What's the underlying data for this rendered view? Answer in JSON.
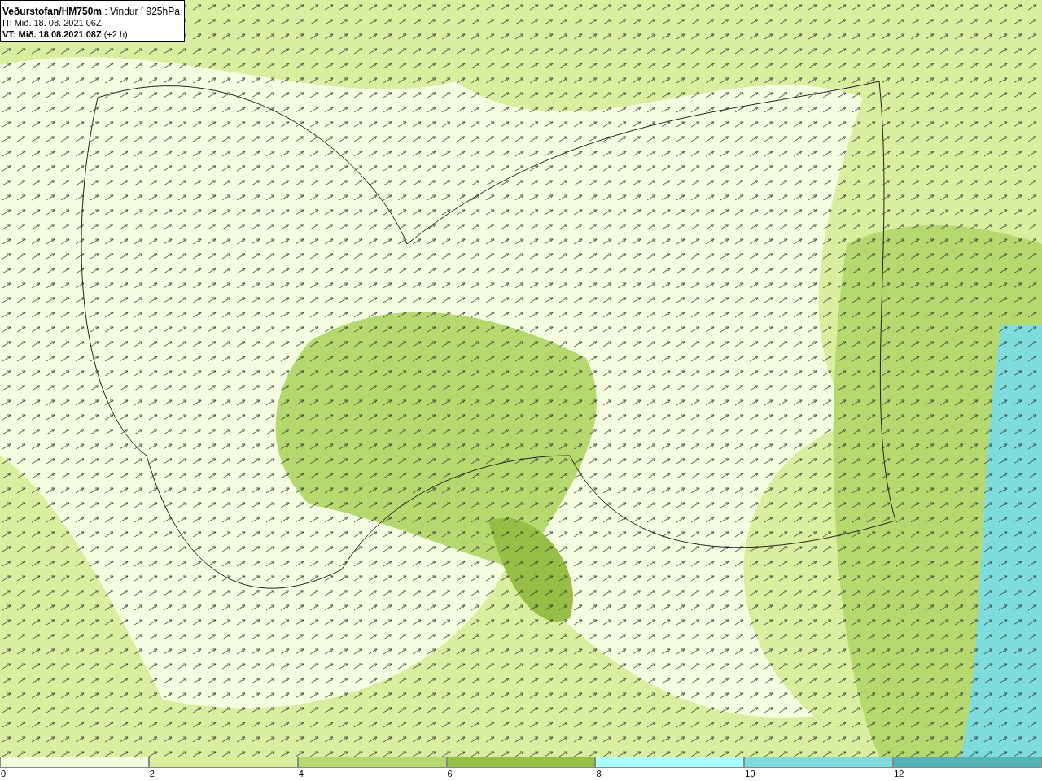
{
  "legend": {
    "lines": [
      "**Veðurstofan/HM750m** : Vindur í 925hPa",
      "IT: Mið. 18. 08. 2021 06Z",
      "**VT: Mið. 18.08.2021 08Z** (+2 h)"
    ]
  },
  "colorbar": [
    {
      "label": "0",
      "color": "#f5fde0"
    },
    {
      "label": "2",
      "color": "#d9ef9f"
    },
    {
      "label": "4",
      "color": "#b5d96e"
    },
    {
      "label": "6",
      "color": "#97bf45"
    },
    {
      "label": "8",
      "color": "#aaffff"
    },
    {
      "label": "10",
      "color": "#7fdcdc"
    },
    {
      "label": "12",
      "color": "#55b4b4"
    }
  ]
}
